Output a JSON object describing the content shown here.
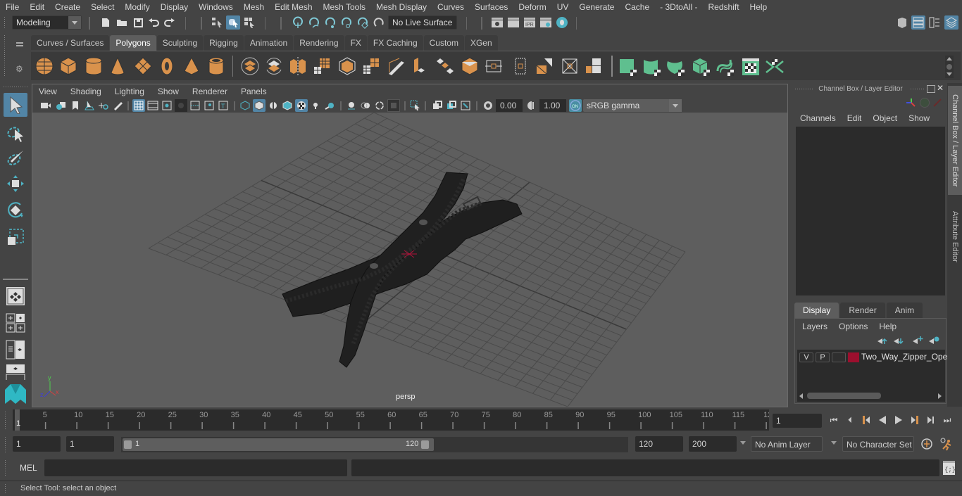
{
  "menubar": {
    "items": [
      "File",
      "Edit",
      "Create",
      "Select",
      "Modify",
      "Display",
      "Windows",
      "Mesh",
      "Edit Mesh",
      "Mesh Tools",
      "Mesh Display",
      "Curves",
      "Surfaces",
      "Deform",
      "UV",
      "Generate",
      "Cache",
      "- 3DtoAll -",
      "Redshift",
      "Help"
    ]
  },
  "statusline": {
    "mode": "Modeling",
    "live_surface": "No Live Surface"
  },
  "shelf": {
    "tabs": [
      "Curves / Surfaces",
      "Polygons",
      "Sculpting",
      "Rigging",
      "Animation",
      "Rendering",
      "FX",
      "FX Caching",
      "Custom",
      "XGen"
    ],
    "active_tab": "Polygons",
    "accent_orange": "#d9924c",
    "accent_green": "#5fbf8f"
  },
  "viewport": {
    "menu": [
      "View",
      "Shading",
      "Lighting",
      "Show",
      "Renderer",
      "Panels"
    ],
    "exposure": "0.00",
    "gamma": "1.00",
    "color_management": "sRGB gamma",
    "camera_label": "persp",
    "axis": {
      "x": "x",
      "y": "y",
      "z": "z"
    }
  },
  "channel_box": {
    "title": "Channel Box / Layer Editor",
    "menu": [
      "Channels",
      "Edit",
      "Object",
      "Show"
    ],
    "layer_tabs": [
      "Display",
      "Render",
      "Anim"
    ],
    "active_layer_tab": "Display",
    "layer_menu": [
      "Layers",
      "Options",
      "Help"
    ],
    "layers": [
      {
        "visible": "V",
        "playback": "P",
        "name": "Two_Way_Zipper_Ope",
        "color": "#9c0f2e"
      }
    ]
  },
  "side_tabs": [
    "Channel Box / Layer Editor",
    "Attribute Editor"
  ],
  "timeline": {
    "ticks": [
      "5",
      "10",
      "15",
      "20",
      "25",
      "30",
      "35",
      "40",
      "45",
      "50",
      "55",
      "60",
      "65",
      "70",
      "75",
      "80",
      "85",
      "90",
      "95",
      "100",
      "105",
      "110",
      "115",
      "12"
    ],
    "current_frame_marker": "1",
    "current_frame": "1"
  },
  "range": {
    "start_frame": "1",
    "playback_start": "1",
    "slider_start": "1",
    "slider_end": "120",
    "playback_end": "120",
    "end_frame": "200",
    "anim_layer": "No Anim Layer",
    "character_set": "No Character Set"
  },
  "command_line": {
    "language": "MEL"
  },
  "help_line": {
    "text": "Select Tool: select an object"
  }
}
